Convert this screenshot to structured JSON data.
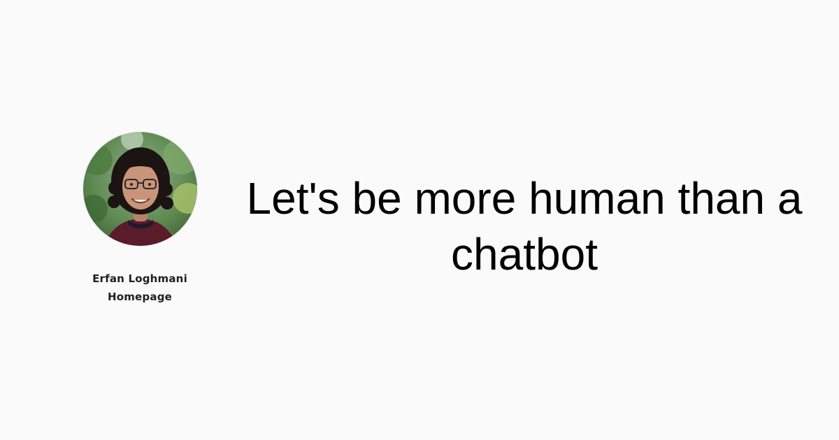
{
  "profile": {
    "name_line1": "Erfan Loghmani",
    "name_line2": "Homepage",
    "avatar_icon": "profile-photo"
  },
  "post": {
    "title": "Let's be more human than a chatbot"
  },
  "colors": {
    "background": "#fafafa",
    "title_text": "#000000",
    "name_text": "#1f1f1f"
  }
}
